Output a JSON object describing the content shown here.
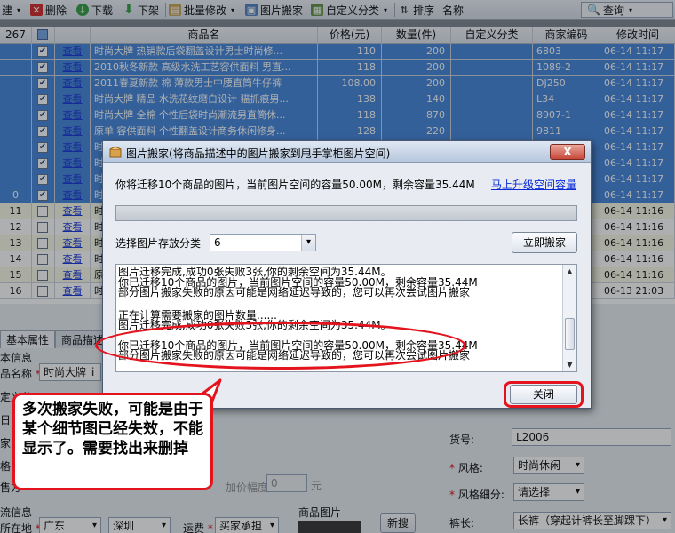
{
  "toolbar": {
    "items": [
      "建",
      "删除",
      "下载",
      "下架",
      "批量修改",
      "图片搬家",
      "自定义分类",
      "排序"
    ],
    "field_label": "名称",
    "query_label": "查询"
  },
  "grid": {
    "corner_label": "267",
    "columns": [
      "商品名",
      "价格(元)",
      "数量(件)",
      "自定义分类",
      "商家编码",
      "修改时间"
    ],
    "rows": [
      {
        "id": "",
        "checked": true,
        "link": "查看",
        "name": "时尚大牌 热销款后袋翻盖设计男士时尚修...",
        "price": "110",
        "qty": "200",
        "code": "6803",
        "time": "06-14 11:17"
      },
      {
        "id": "",
        "checked": true,
        "link": "查看",
        "name": "2010秋冬新款 高级水洗工艺容供面料 男直...",
        "price": "118",
        "qty": "200",
        "code": "1089-2",
        "time": "06-14 11:17"
      },
      {
        "id": "",
        "checked": true,
        "link": "查看",
        "name": "2011春夏新款 棉 薄款男士中腰直筒牛仔裤",
        "price": "108.00",
        "qty": "200",
        "code": "DJ250",
        "time": "06-14 11:17"
      },
      {
        "id": "",
        "checked": true,
        "link": "查看",
        "name": "时尚大牌 精品 水洗花纹磨白设计 猫抓痕男...",
        "price": "138",
        "qty": "140",
        "code": "L34",
        "time": "06-14 11:17"
      },
      {
        "id": "",
        "checked": true,
        "link": "查看",
        "name": "时尚大牌 全棉 个性后袋时尚潮流男直筒休...",
        "price": "118",
        "qty": "870",
        "code": "8907-1",
        "time": "06-14 11:17"
      },
      {
        "id": "",
        "checked": true,
        "link": "查看",
        "name": "原单 容供面料 个性翻盖设计商务休闲修身...",
        "price": "128",
        "qty": "220",
        "code": "9811",
        "time": "06-14 11:17"
      },
      {
        "id": "",
        "checked": true,
        "link": "查看",
        "name": "时",
        "price": "",
        "qty": "",
        "code": "",
        "time": "06-14 11:17"
      },
      {
        "id": "",
        "checked": true,
        "link": "查看",
        "name": "时",
        "price": "",
        "qty": "",
        "code": "",
        "time": "06-14 11:17"
      },
      {
        "id": "",
        "checked": true,
        "link": "查看",
        "name": "时",
        "price": "",
        "qty": "",
        "code": "",
        "time": "06-14 11:17"
      },
      {
        "id": "0",
        "checked": true,
        "link": "查看",
        "name": "时",
        "price": "",
        "qty": "",
        "code": "",
        "time": "06-14 11:17"
      },
      {
        "id": "11",
        "checked": false,
        "link": "查看",
        "name": "时",
        "price": "",
        "qty": "",
        "code": "",
        "time": "06-14 11:16"
      },
      {
        "id": "12",
        "checked": false,
        "link": "查看",
        "name": "时",
        "price": "",
        "qty": "",
        "code": "",
        "time": "06-14 11:16"
      },
      {
        "id": "13",
        "checked": false,
        "link": "查看",
        "name": "时",
        "price": "",
        "qty": "",
        "code": "",
        "time": "06-14 11:16"
      },
      {
        "id": "14",
        "checked": false,
        "link": "查看",
        "name": "时",
        "price": "",
        "qty": "",
        "code": "",
        "time": "06-14 11:16"
      },
      {
        "id": "15",
        "checked": false,
        "link": "查看",
        "name": "原",
        "price": "",
        "qty": "",
        "code": "",
        "time": "06-14 11:16"
      },
      {
        "id": "16",
        "checked": false,
        "link": "查看",
        "name": "时",
        "price": "",
        "qty": "",
        "code": "",
        "time": "06-13 21:03"
      }
    ]
  },
  "form": {
    "tabs": [
      "基本属性",
      "商品描述"
    ],
    "section_info": "本信息",
    "name_label": "品名称",
    "name_value": "时尚大牌 ⅱ",
    "custom_label": "定义分",
    "left_labels": [
      "日",
      "家",
      "格",
      "售方"
    ],
    "price_label": "加价幅度",
    "price_value": "0",
    "price_unit": "元",
    "section_logistics": "流信息",
    "location_label": "所在地",
    "province": "广东",
    "city": "深圳",
    "freight_label": "运费",
    "freight_value": "买家承担",
    "images_label": "商品图片",
    "new_button": "新搜",
    "huohao_label": "货号:",
    "huohao_value": "L2006",
    "style_label": "风格:",
    "style_value": "时尚休闲",
    "style_detail_label": "风格细分:",
    "style_detail_value": "请选择",
    "length_label": "裤长:",
    "length_value": "长裤（穿起计裤长至脚踝下）"
  },
  "dialog": {
    "title": "图片搬家(将商品描述中的图片搬家到甩手掌柜图片空间)",
    "close_symbol": "X",
    "info": "你将迁移10个商品的图片，当前图片空间的容量50.00M，剩余容量35.44M",
    "upgrade_link": "马上升级空间容量",
    "progress": 0,
    "category_label": "选择图片存放分类",
    "category_value": "6",
    "move_button": "立即搬家",
    "log_lines": [
      "图片迁移完成,成功0张失败3张,你的剩余空间为35.44M。",
      "你已迁移10个商品的图片，当前图片空间的容量50.00M，剩余容量35.44M",
      "部分图片搬家失败的原因可能是网络延迟导致的，您可以再次尝试图片搬家",
      "",
      "正在计算需要搬家的图片数量......",
      "图片迁移完成,成功0张失败3张,你的剩余空间为35.44M。",
      "你已迁移10个商品的图片，当前图片空间的容量50.00M，剩余容量35.44M",
      "部分图片搬家失败的原因可能是网络延迟导致的，您可以再次尝试图片搬家"
    ],
    "close_button": "关闭"
  },
  "annotation": {
    "callout_text": "多次搬家失败，可能是由于某个细节图已经失效，不能显示了。需要找出来删掉",
    "highlight_color": "#e4141e"
  },
  "colors": {
    "selected_row": "#3d80d8",
    "link": "#0a2bd6",
    "annotation": "#e4141e"
  }
}
